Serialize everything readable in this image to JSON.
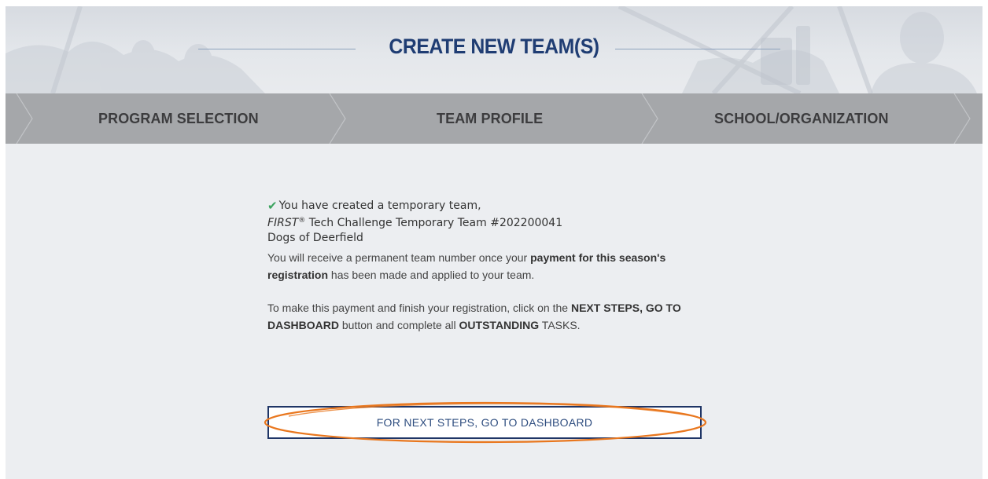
{
  "banner": {
    "title": "CREATE NEW TEAM(S)"
  },
  "steps": [
    {
      "label": "PROGRAM SELECTION"
    },
    {
      "label": "TEAM PROFILE"
    },
    {
      "label": "SCHOOL/ORGANIZATION"
    }
  ],
  "confirmation": {
    "line1": "You have created a temporary team,",
    "program_name": "FIRST",
    "registered_mark": "®",
    "line2_rest": " Tech Challenge Temporary Team #202200041",
    "team_name": "Dogs of Deerfield"
  },
  "info": {
    "p1_a": "You will receive a permanent team number once your ",
    "p1_b": "payment for this season's registration",
    "p1_c": " has been made and applied to your team.",
    "p2_a": "To make this payment and finish your registration, click on the ",
    "p2_b": "NEXT STEPS, GO TO DASHBOARD",
    "p2_c": " button and complete all ",
    "p2_d": "OUTSTANDING",
    "p2_e": " TASKS."
  },
  "dashboard_button": {
    "label": "FOR NEXT STEPS, GO TO DASHBOARD"
  },
  "colors": {
    "title": "#1f3d73",
    "step_bar": "#a5a7aa",
    "check": "#3ba35e",
    "button_border": "#1f3566",
    "highlight": "#e9771e"
  },
  "icons": {
    "confirm": "check-icon"
  }
}
